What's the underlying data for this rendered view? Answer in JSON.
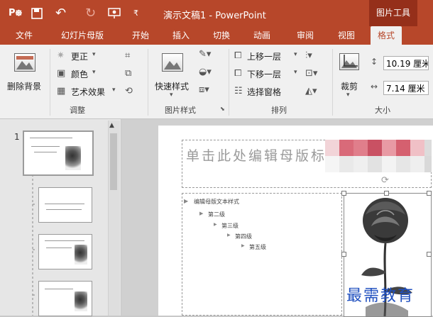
{
  "titlebar": {
    "app_title": "演示文稿1 - PowerPoint",
    "tools_label": "图片工具",
    "quick_access_icons": [
      "powerpoint-icon",
      "save-icon",
      "undo-icon",
      "redo-icon",
      "slideshow-icon",
      "customize-icon"
    ]
  },
  "tabs": [
    "文件",
    "幻灯片母版",
    "开始",
    "插入",
    "切换",
    "动画",
    "审阅",
    "视图",
    "格式"
  ],
  "active_tab": "格式",
  "ribbon": {
    "remove_bg": "删除背景",
    "adjust": {
      "corrections": "更正",
      "color": "颜色",
      "artistic": "艺术效果",
      "group": "调整"
    },
    "styles": {
      "quick_styles": "快速样式",
      "group": "图片样式"
    },
    "arrange": {
      "bring_forward": "上移一层",
      "send_backward": "下移一层",
      "selection_pane": "选择窗格",
      "group": "排列"
    },
    "size": {
      "crop": "裁剪",
      "height": "10.19 厘米",
      "width": "7.14 厘米",
      "group": "大小"
    }
  },
  "thumbnails": {
    "first_index": "1"
  },
  "slide": {
    "title_placeholder": "单击此处编辑母版标题",
    "levels": [
      "编辑母版文本样式",
      "第二级",
      "第三级",
      "第四级",
      "第五级"
    ]
  },
  "watermark": "最需教育",
  "colors": {
    "accent": "#b7472a",
    "accent_dark": "#952f1a",
    "ribbon_bg": "#f0f0f0",
    "watermark": "#1f4fbf"
  }
}
